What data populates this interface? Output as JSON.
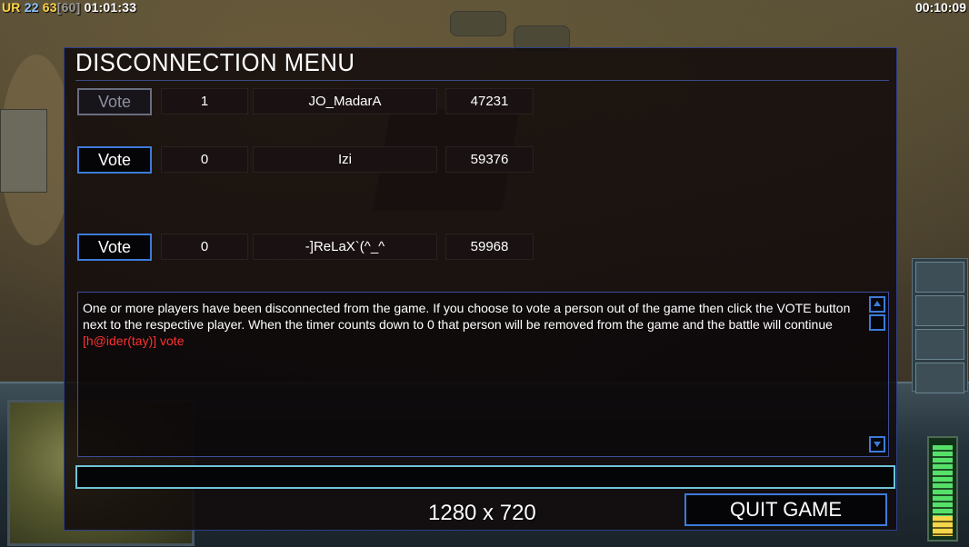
{
  "hud": {
    "label_ur": "UR",
    "value_22": "22",
    "value_63": "63",
    "value_60": "[60]",
    "game_time": "01:01:33",
    "clock": "00:10:09"
  },
  "panel": {
    "title": "DISCONNECTION MENU",
    "players": [
      {
        "vote_label": "Vote",
        "votes": "1",
        "name": "JO_MadarA",
        "ping": "47231",
        "vote_enabled": false
      },
      {
        "vote_label": "Vote",
        "votes": "0",
        "name": "Izi",
        "ping": "59376",
        "vote_enabled": true
      },
      {
        "vote_label": "Vote",
        "votes": "0",
        "name": "-]ReLaX`(^_^",
        "ping": "59968",
        "vote_enabled": true
      }
    ],
    "message": "One or more players have been disconnected from the game. If you choose to vote a person out of the game then click the VOTE button next to the respective player. When the timer counts down to 0 that person will be removed from the game and the battle will continue",
    "chat_line": "[h@ider(tay)] vote",
    "chat_input_value": "",
    "quit_label": "QUIT GAME",
    "resolution": "1280 x 720"
  },
  "colors": {
    "accent_blue": "#3d7bd9",
    "chat_red": "#ff3030",
    "input_cyan": "#6fc4d6"
  }
}
